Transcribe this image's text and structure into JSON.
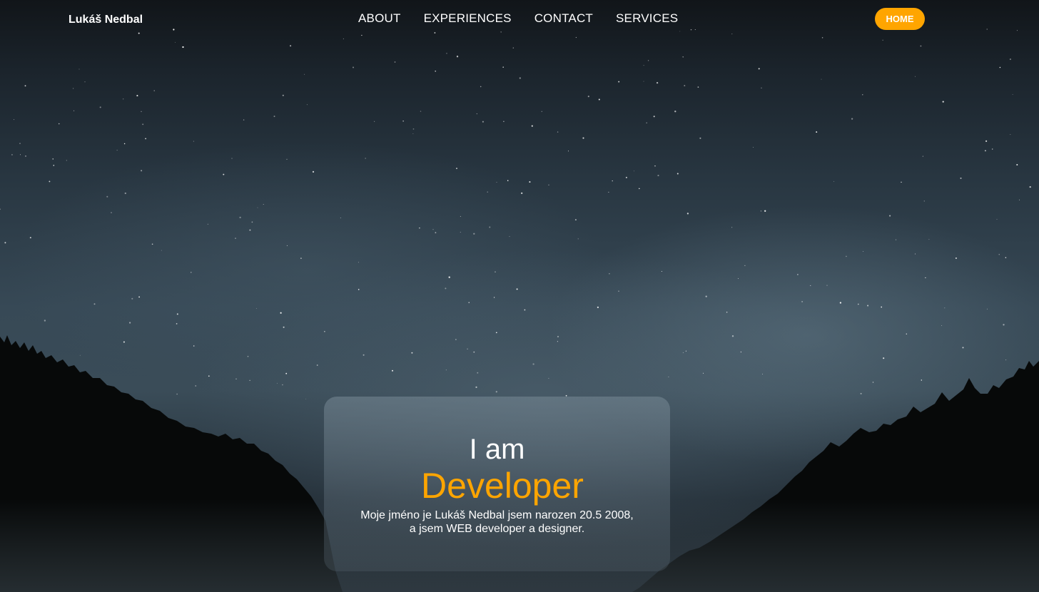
{
  "nav": {
    "brand": "Lukáš Nedbal",
    "links": [
      "ABOUT",
      "EXPERIENCES",
      "CONTACT",
      "SERVICES"
    ],
    "home_button": "HOME"
  },
  "hero": {
    "intro": "I am",
    "role": "Developer",
    "description_line1": "Moje jméno je Lukáš Nedbal jsem narozen 20.5 2008,",
    "description_line2": "a jsem WEB developer a designer."
  },
  "colors": {
    "accent": "#ffa500",
    "text": "#ffffff",
    "sky_dark": "#111519",
    "sky_light": "#3a4c58",
    "forest": "#070909"
  }
}
